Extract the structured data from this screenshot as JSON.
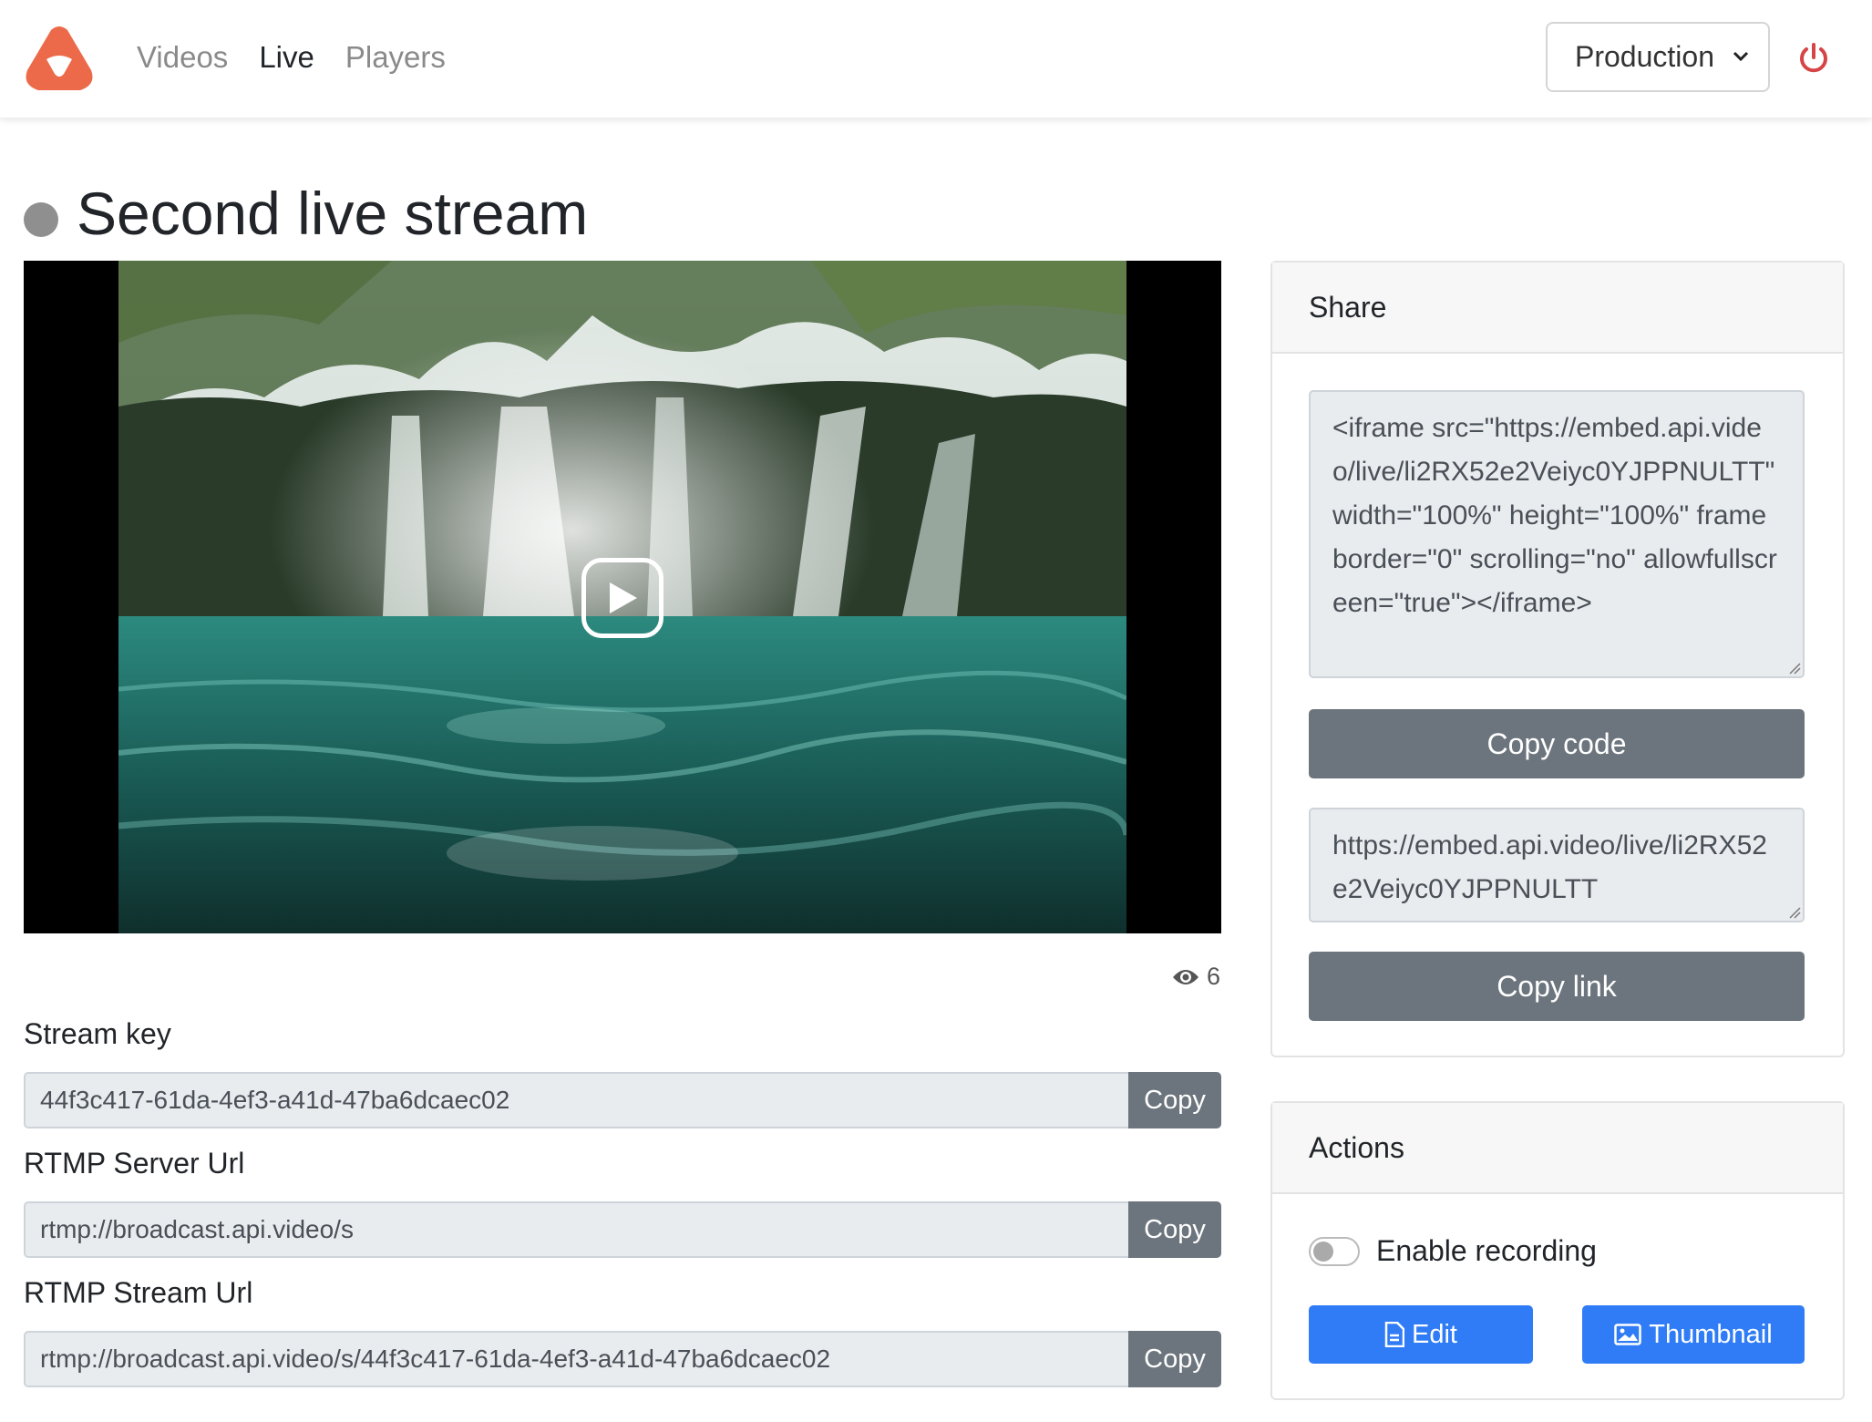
{
  "nav": {
    "links": [
      "Videos",
      "Live",
      "Players"
    ],
    "active": "Live",
    "environment": "Production"
  },
  "stream": {
    "title": "Second live stream",
    "status_color": "#8f8f8f",
    "views": "6"
  },
  "fields": {
    "stream_key": {
      "label": "Stream key",
      "value": "44f3c417-61da-4ef3-a41d-47ba6dcaec02",
      "button": "Copy"
    },
    "rtmp_server": {
      "label": "RTMP Server Url",
      "value": "rtmp://broadcast.api.video/s",
      "button": "Copy"
    },
    "rtmp_stream": {
      "label": "RTMP Stream Url",
      "value": "rtmp://broadcast.api.video/s/44f3c417-61da-4ef3-a41d-47ba6dcaec02",
      "button": "Copy"
    }
  },
  "share": {
    "header": "Share",
    "embed_code": "<iframe src=\"https://embed.api.video/live/li2RX52e2Veiyc0YJPPNULTT\" width=\"100%\" height=\"100%\" frameborder=\"0\" scrolling=\"no\" allowfullscreen=\"true\"></iframe>",
    "copy_code_label": "Copy code",
    "link": "https://embed.api.video/live/li2RX52e2Veiyc0YJPPNULTT",
    "copy_link_label": "Copy link"
  },
  "actions": {
    "header": "Actions",
    "recording_label": "Enable recording",
    "recording_enabled": false,
    "edit_label": "Edit",
    "thumbnail_label": "Thumbnail"
  },
  "colors": {
    "brand": "#ec6a4a",
    "power": "#d64545",
    "primary": "#2f7cf6",
    "secondary": "#6c757d"
  }
}
